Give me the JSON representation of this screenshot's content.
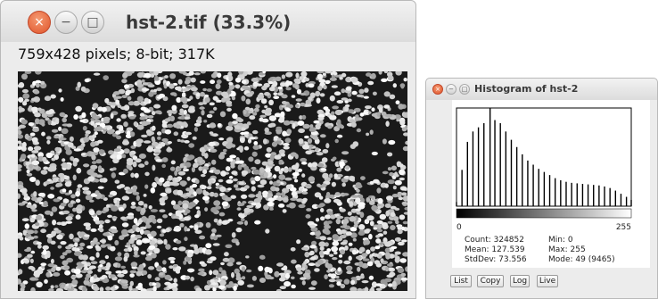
{
  "image_window": {
    "title": "hst-2.tif (33.3%)",
    "info": "759x428 pixels; 8-bit; 317K"
  },
  "histogram_window": {
    "title": "Histogram of hst-2",
    "axis_min_label": "0",
    "axis_max_label": "255",
    "stats": {
      "count": "Count: 324852",
      "mean": "Mean: 127.539",
      "stddev": "StdDev: 73.556",
      "min": "Min: 0",
      "max": "Max: 255",
      "mode": "Mode: 49 (9465)"
    },
    "buttons": {
      "list": "List",
      "copy": "Copy",
      "log": "Log",
      "live": "Live"
    }
  },
  "icons": {
    "close": "×",
    "minimize": "−",
    "maximize": "□"
  },
  "chart_data": {
    "type": "bar",
    "xlim": [
      0,
      255
    ],
    "ylim": [
      0,
      9465
    ],
    "x": [
      0,
      8,
      16,
      24,
      32,
      40,
      49,
      56,
      64,
      72,
      80,
      88,
      96,
      104,
      112,
      120,
      128,
      136,
      144,
      152,
      160,
      168,
      176,
      184,
      192,
      200,
      208,
      216,
      224,
      232,
      240,
      248,
      255
    ],
    "values": [
      400,
      3500,
      6200,
      7200,
      7600,
      8000,
      9465,
      8300,
      8000,
      7200,
      6400,
      5700,
      5000,
      4400,
      4000,
      3600,
      3300,
      3000,
      2700,
      2500,
      2350,
      2250,
      2200,
      2150,
      2100,
      2050,
      2000,
      1900,
      1750,
      1500,
      1200,
      900,
      600
    ]
  }
}
